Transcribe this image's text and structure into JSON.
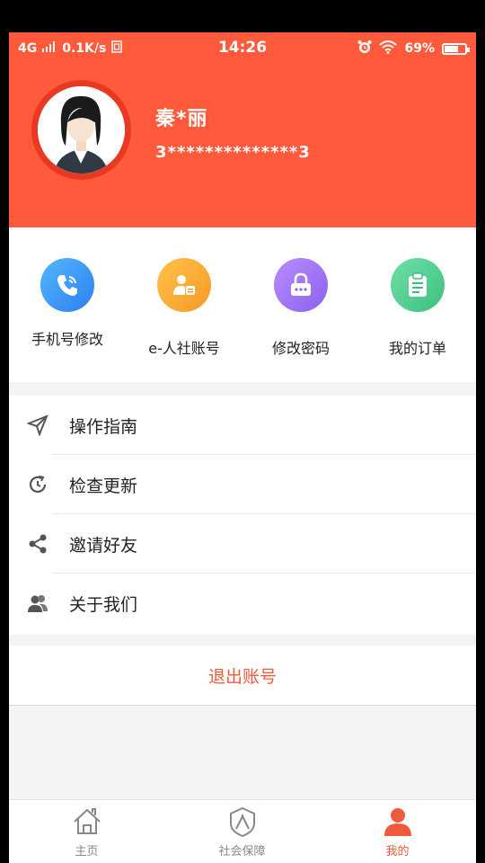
{
  "status_bar": {
    "network": "4G",
    "speed": "0.1K/s",
    "time": "14:26",
    "battery": "69%",
    "battery_level": 0.69
  },
  "profile": {
    "name": "秦*丽",
    "id_masked": "3**************3"
  },
  "quick_actions": [
    {
      "label": "手机号修改",
      "icon": "phone-icon",
      "color": "#3a8ff0"
    },
    {
      "label": "e-人社账号",
      "icon": "person-card-icon",
      "color": "#f7a531"
    },
    {
      "label": "修改密码",
      "icon": "lock-icon",
      "color": "#9b6ff0"
    },
    {
      "label": "我的订单",
      "icon": "clipboard-icon",
      "color": "#4ec98c"
    }
  ],
  "menu": [
    {
      "label": "操作指南",
      "icon": "compass-icon"
    },
    {
      "label": "检查更新",
      "icon": "refresh-clock-icon"
    },
    {
      "label": "邀请好友",
      "icon": "share-icon"
    },
    {
      "label": "关于我们",
      "icon": "people-icon"
    }
  ],
  "logout_label": "退出账号",
  "bottom_nav": [
    {
      "label": "主页",
      "icon": "home-icon",
      "active": false
    },
    {
      "label": "社会保障",
      "icon": "shield-person-icon",
      "active": false
    },
    {
      "label": "我的",
      "icon": "user-icon",
      "active": true
    }
  ],
  "colors": {
    "brand": "#ff5a3c",
    "accent_text": "#f05a3a"
  }
}
